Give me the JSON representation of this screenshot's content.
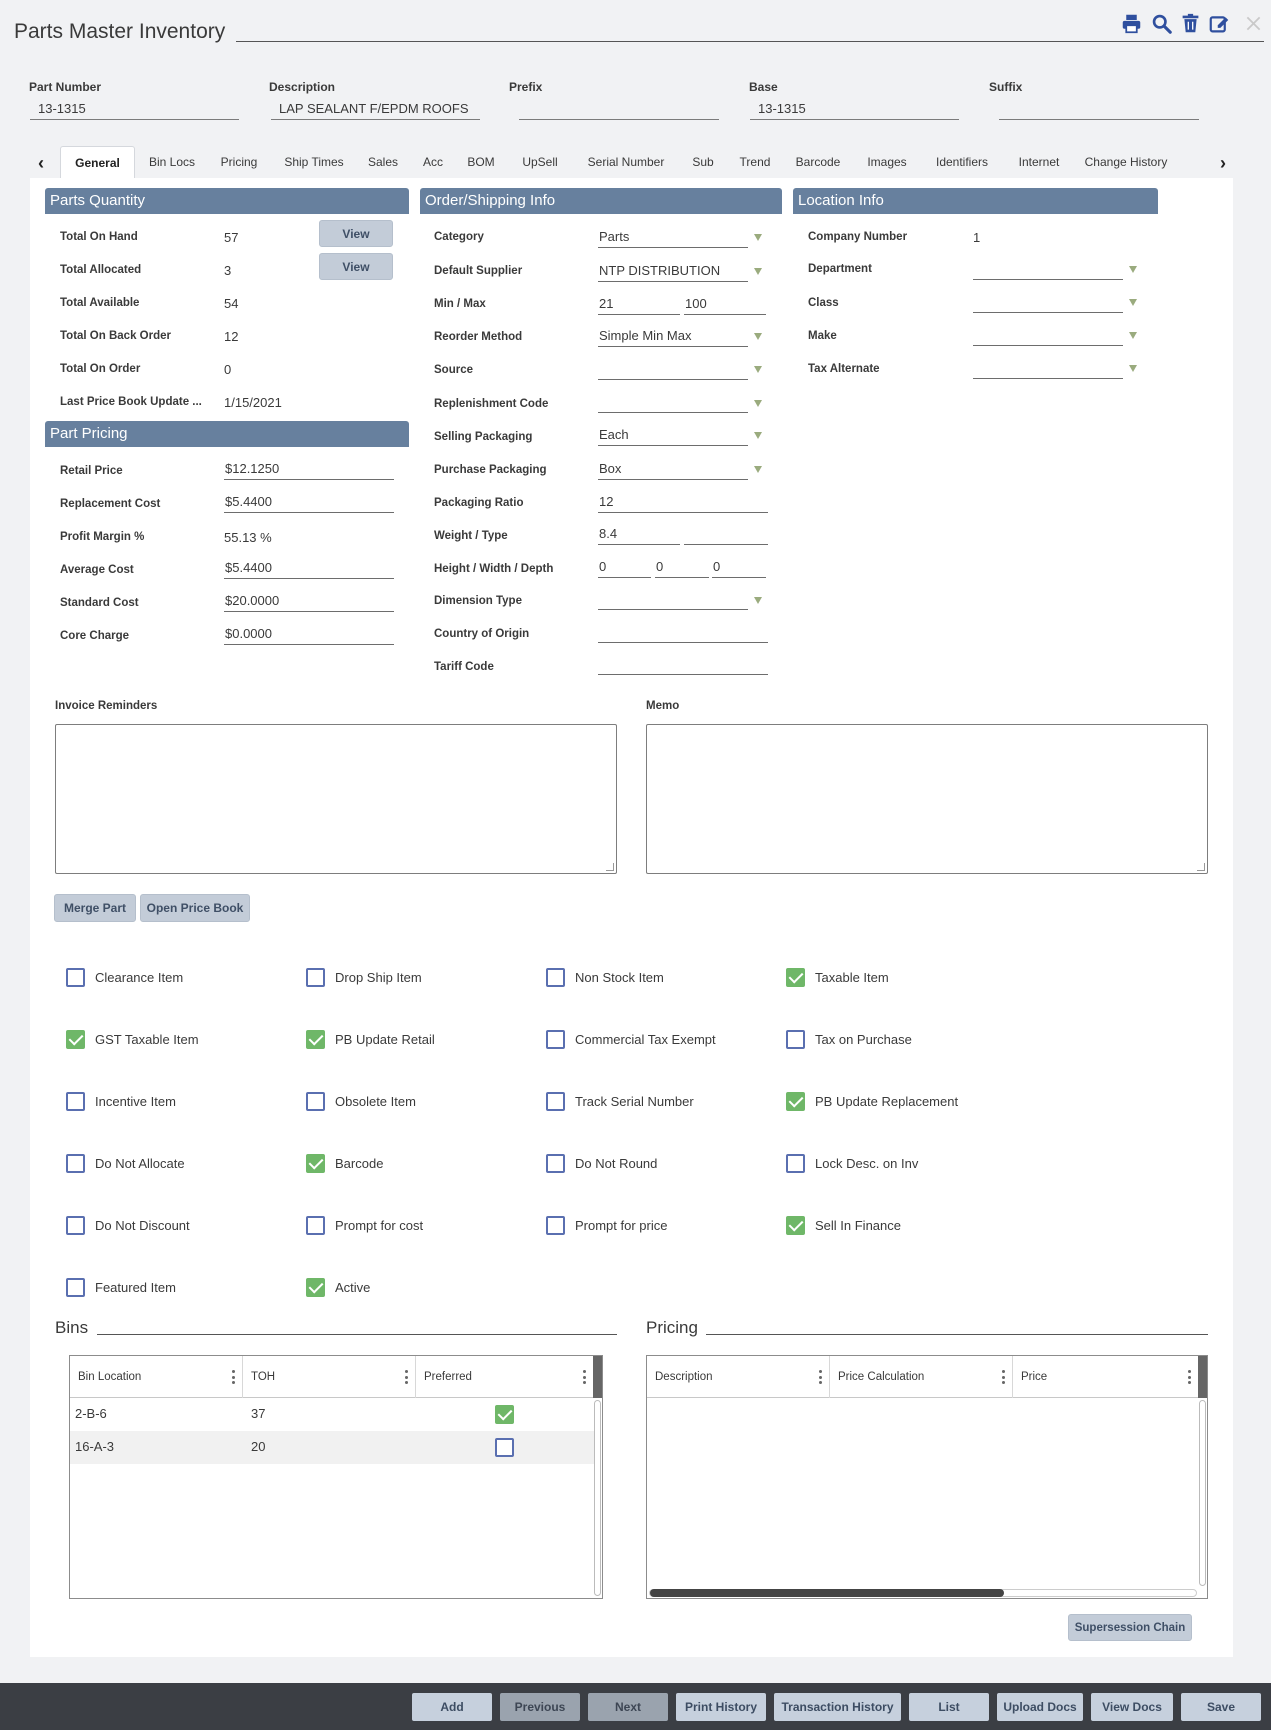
{
  "window": {
    "title": "Parts Master Inventory"
  },
  "toolbar_icons": [
    "print-icon",
    "search-icon",
    "delete-icon",
    "edit-icon",
    "close-icon"
  ],
  "header": {
    "part_number": {
      "label": "Part Number",
      "value": "13-1315"
    },
    "description": {
      "label": "Description",
      "value": "LAP SEALANT F/EPDM ROOFS"
    },
    "prefix": {
      "label": "Prefix",
      "value": ""
    },
    "base": {
      "label": "Base",
      "value": "13-1315"
    },
    "suffix": {
      "label": "Suffix",
      "value": ""
    }
  },
  "tabs": [
    "General",
    "Bin Locs",
    "Pricing",
    "Ship Times",
    "Sales",
    "Acc",
    "BOM",
    "UpSell",
    "Serial Number",
    "Sub",
    "Trend",
    "Barcode",
    "Images",
    "Identifiers",
    "Internet",
    "Change History"
  ],
  "active_tab": "General",
  "parts_quantity": {
    "title": "Parts Quantity",
    "view_label": "View",
    "rows": [
      {
        "label": "Total On Hand",
        "value": "57"
      },
      {
        "label": "Total Allocated",
        "value": "3"
      },
      {
        "label": "Total Available",
        "value": "54"
      },
      {
        "label": "Total On Back Order",
        "value": "12"
      },
      {
        "label": "Total On Order",
        "value": "0"
      },
      {
        "label": "Last Price Book Update ...",
        "value": "1/15/2021"
      }
    ]
  },
  "part_pricing": {
    "title": "Part Pricing",
    "rows": [
      {
        "label": "Retail Price",
        "value": "$12.1250"
      },
      {
        "label": "Replacement Cost",
        "value": "$5.4400"
      },
      {
        "label": "Profit Margin %",
        "value": "55.13 %"
      },
      {
        "label": "Average Cost",
        "value": "$5.4400"
      },
      {
        "label": "Standard Cost",
        "value": "$20.0000"
      },
      {
        "label": "Core Charge",
        "value": "$0.0000"
      }
    ]
  },
  "order_shipping": {
    "title": "Order/Shipping Info",
    "category": {
      "label": "Category",
      "value": "Parts"
    },
    "default_supplier": {
      "label": "Default Supplier",
      "value": "NTP DISTRIBUTION"
    },
    "min_max": {
      "label": "Min / Max",
      "min": "21",
      "max": "100"
    },
    "reorder_method": {
      "label": "Reorder Method",
      "value": "Simple Min Max"
    },
    "source": {
      "label": "Source",
      "value": ""
    },
    "replenishment_code": {
      "label": "Replenishment Code",
      "value": ""
    },
    "selling_packaging": {
      "label": "Selling Packaging",
      "value": "Each"
    },
    "purchase_packaging": {
      "label": "Purchase Packaging",
      "value": "Box"
    },
    "packaging_ratio": {
      "label": "Packaging Ratio",
      "value": "12"
    },
    "weight_type": {
      "label": "Weight / Type",
      "weight": "8.4",
      "type": ""
    },
    "hwd": {
      "label": "Height / Width / Depth",
      "height": "0",
      "width": "0",
      "depth": "0"
    },
    "dimension_type": {
      "label": "Dimension Type",
      "value": ""
    },
    "country_of_origin": {
      "label": "Country of Origin",
      "value": ""
    },
    "tariff_code": {
      "label": "Tariff Code",
      "value": ""
    }
  },
  "location_info": {
    "title": "Location Info",
    "company_number": {
      "label": "Company Number",
      "value": "1"
    },
    "department": {
      "label": "Department",
      "value": ""
    },
    "class": {
      "label": "Class",
      "value": ""
    },
    "make": {
      "label": "Make",
      "value": ""
    },
    "tax_alternate": {
      "label": "Tax Alternate",
      "value": ""
    }
  },
  "notes": {
    "invoice_reminders_label": "Invoice Reminders",
    "invoice_reminders_value": "",
    "memo_label": "Memo",
    "memo_value": ""
  },
  "actions": {
    "merge_part": "Merge Part",
    "open_price_book": "Open Price Book"
  },
  "checkboxes": [
    {
      "label": "Clearance Item",
      "checked": false
    },
    {
      "label": "Drop Ship Item",
      "checked": false
    },
    {
      "label": "Non Stock Item",
      "checked": false
    },
    {
      "label": "Taxable Item",
      "checked": true
    },
    {
      "label": "GST Taxable Item",
      "checked": true
    },
    {
      "label": "PB Update Retail",
      "checked": true
    },
    {
      "label": "Commercial Tax Exempt",
      "checked": false
    },
    {
      "label": "Tax on Purchase",
      "checked": false
    },
    {
      "label": "Incentive Item",
      "checked": false
    },
    {
      "label": "Obsolete Item",
      "checked": false
    },
    {
      "label": "Track Serial Number",
      "checked": false
    },
    {
      "label": "PB Update Replacement",
      "checked": true
    },
    {
      "label": "Do Not Allocate",
      "checked": false
    },
    {
      "label": "Barcode",
      "checked": true
    },
    {
      "label": "Do Not Round",
      "checked": false
    },
    {
      "label": "Lock Desc. on Inv",
      "checked": false
    },
    {
      "label": "Do Not Discount",
      "checked": false
    },
    {
      "label": "Prompt for cost",
      "checked": false
    },
    {
      "label": "Prompt for price",
      "checked": false
    },
    {
      "label": "Sell In Finance",
      "checked": true
    },
    {
      "label": "Featured Item",
      "checked": false
    },
    {
      "label": "Active",
      "checked": true
    }
  ],
  "bins": {
    "title": "Bins",
    "columns": [
      "Bin Location",
      "TOH",
      "Preferred"
    ],
    "rows": [
      {
        "bin_location": "2-B-6",
        "toh": "37",
        "preferred": true
      },
      {
        "bin_location": "16-A-3",
        "toh": "20",
        "preferred": false
      }
    ]
  },
  "pricing_grid": {
    "title": "Pricing",
    "columns": [
      "Description",
      "Price Calculation",
      "Price"
    ],
    "rows": []
  },
  "supersession_chain": "Supersession Chain",
  "footer_buttons": [
    {
      "label": "Add",
      "enabled": true
    },
    {
      "label": "Previous",
      "enabled": false
    },
    {
      "label": "Next",
      "enabled": false
    },
    {
      "label": "Print History",
      "enabled": true
    },
    {
      "label": "Transaction History",
      "enabled": true
    },
    {
      "label": "List",
      "enabled": true
    },
    {
      "label": "Upload Docs",
      "enabled": true
    },
    {
      "label": "View Docs",
      "enabled": true
    },
    {
      "label": "Save",
      "enabled": true
    }
  ],
  "colors": {
    "section_band": "#67809e",
    "checkbox_checked": "#6fb768",
    "checkbox_border": "#5a6fb0",
    "button_bg": "#c3ccd8",
    "footer_bg": "#3b3e44"
  }
}
